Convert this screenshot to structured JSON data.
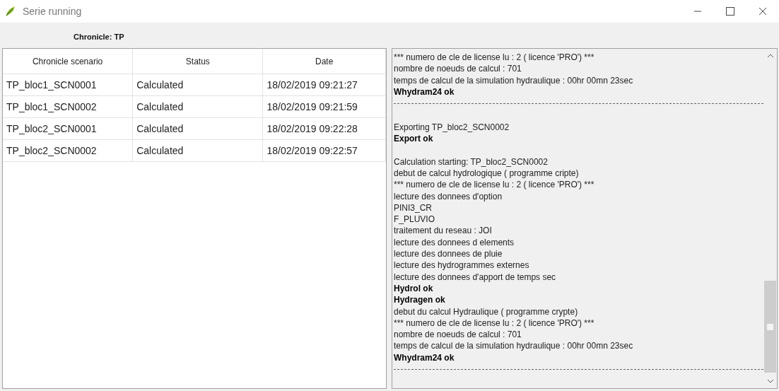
{
  "window": {
    "title": "Serie running"
  },
  "chronicle_label": "Chronicle: TP",
  "table": {
    "columns": [
      "Chronicle scenario",
      "Status",
      "Date"
    ],
    "rows": [
      {
        "cells": [
          "TP_bloc1_SCN0001",
          "Calculated",
          "18/02/2019 09:21:27"
        ]
      },
      {
        "cells": [
          "TP_bloc1_SCN0002",
          "Calculated",
          "18/02/2019 09:21:59"
        ]
      },
      {
        "cells": [
          "TP_bloc2_SCN0001",
          "Calculated",
          "18/02/2019 09:22:28"
        ]
      },
      {
        "cells": [
          "TP_bloc2_SCN0002",
          "Calculated",
          "18/02/2019 09:22:57"
        ]
      }
    ]
  },
  "log": [
    {
      "kind": "text",
      "text": "*** numero de cle de license lu : 2 ( licence 'PRO') ***"
    },
    {
      "kind": "text",
      "text": "nombre de noeuds de calcul : 701"
    },
    {
      "kind": "text",
      "text": "temps de calcul de la simulation hydraulique : 00hr 00mn 23sec"
    },
    {
      "kind": "bold",
      "text": "Whydram24 ok"
    },
    {
      "kind": "separator"
    },
    {
      "kind": "blank"
    },
    {
      "kind": "text",
      "text": "Exporting TP_bloc2_SCN0002"
    },
    {
      "kind": "bold",
      "text": "Export ok"
    },
    {
      "kind": "blank"
    },
    {
      "kind": "text",
      "text": "Calculation starting: TP_bloc2_SCN0002"
    },
    {
      "kind": "text",
      "text": "debut de calcul hydrologique ( programme cripte)"
    },
    {
      "kind": "text",
      "text": "*** numero de cle de license lu : 2 ( licence 'PRO') ***"
    },
    {
      "kind": "text",
      "text": "lecture des donnees d'option"
    },
    {
      "kind": "text",
      "text": "PINI3_CR"
    },
    {
      "kind": "text",
      "text": "F_PLUVIO"
    },
    {
      "kind": "text",
      "text": "traitement du reseau : JOI"
    },
    {
      "kind": "text",
      "text": "lecture des donnees d elements"
    },
    {
      "kind": "text",
      "text": "lecture des donnees de pluie"
    },
    {
      "kind": "text",
      "text": "lecture des hydrogrammes externes"
    },
    {
      "kind": "text",
      "text": "lecture des donnees d'apport de temps sec"
    },
    {
      "kind": "bold",
      "text": "Hydrol ok"
    },
    {
      "kind": "bold",
      "text": "Hydragen ok"
    },
    {
      "kind": "text",
      "text": "debut du calcul Hydraulique ( programme crypte)"
    },
    {
      "kind": "text",
      "text": "*** numero de cle de license lu : 2 ( licence 'PRO') ***"
    },
    {
      "kind": "text",
      "text": "nombre de noeuds de calcul : 701"
    },
    {
      "kind": "text",
      "text": "temps de calcul de la simulation hydraulique : 00hr 00mn 23sec"
    },
    {
      "kind": "bold",
      "text": "Whydram24 ok"
    },
    {
      "kind": "separator"
    }
  ]
}
